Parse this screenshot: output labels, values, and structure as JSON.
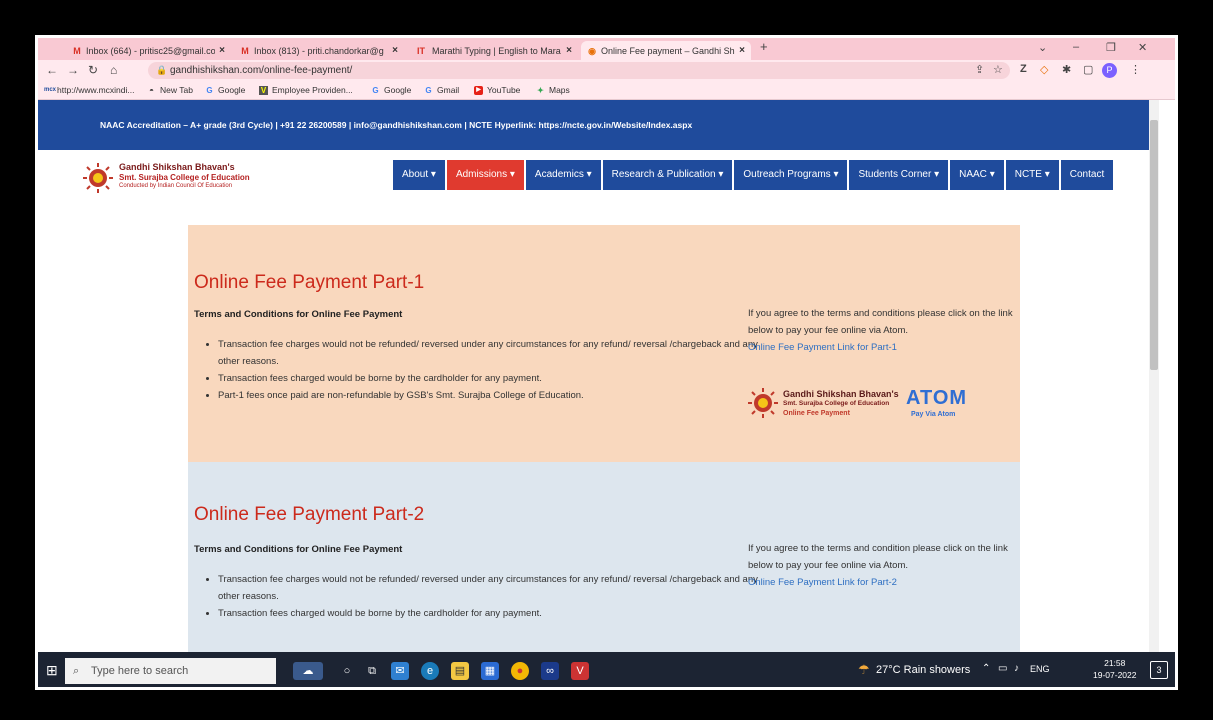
{
  "browser": {
    "tabs": [
      {
        "label": "Inbox (664) - pritisc25@gmail.co",
        "icon": "M",
        "color": "#d93025"
      },
      {
        "label": "Inbox (813) - priti.chandorkar@g",
        "icon": "M",
        "color": "#d93025"
      },
      {
        "label": "Marathi Typing | English to Mara",
        "icon": "IT",
        "color": "#d93025"
      },
      {
        "label": "Online Fee payment – Gandhi Sh",
        "icon": "◉",
        "color": "#e8710a"
      }
    ],
    "new_tab": "+",
    "url": "gandhishikshan.com/online-fee-payment/",
    "profile_initial": "P",
    "bookmarks": [
      {
        "label": "http://www.mcxindi...",
        "icon": "mcx"
      },
      {
        "label": "New Tab",
        "icon": "◓"
      },
      {
        "label": "Google",
        "icon": "G"
      },
      {
        "label": "Employee Providen...",
        "icon": "V"
      },
      {
        "label": "Google",
        "icon": "G"
      },
      {
        "label": "Gmail",
        "icon": "G"
      },
      {
        "label": "YouTube",
        "icon": "▶"
      },
      {
        "label": "Maps",
        "icon": "✦"
      }
    ]
  },
  "site": {
    "topbar": "NAAC Accreditation – A+ grade (3rd Cycle) | +91 22 26200589 | info@gandhishikshan.com | NCTE Hyperlink: https://ncte.gov.in/Website/Index.aspx",
    "logo_line1": "Gandhi Shikshan Bhavan's",
    "logo_line2": "Smt. Surajba College of Education",
    "logo_line3": "Conducted by Indian Council Of Education",
    "nav": [
      {
        "label": "About",
        "caret": "▾"
      },
      {
        "label": "Admissions",
        "caret": "▾"
      },
      {
        "label": "Academics",
        "caret": "▾"
      },
      {
        "label": "Research & Publication",
        "caret": "▾"
      },
      {
        "label": "Outreach Programs",
        "caret": "▾"
      },
      {
        "label": "Students Corner",
        "caret": "▾"
      },
      {
        "label": "NAAC",
        "caret": "▾"
      },
      {
        "label": "NCTE",
        "caret": "▾"
      },
      {
        "label": "Contact",
        "caret": ""
      }
    ],
    "section1": {
      "title": "Online Fee Payment Part-1",
      "terms_heading": "Terms and Conditions for Online Fee Payment",
      "bullets": [
        "Transaction fee charges would not be refunded/ reversed under any circumstances for any refund/ reversal /chargeback and any other reasons.",
        "Transaction fees charged would be borne by the cardholder for any payment.",
        "Part-1 fees once paid are non-refundable by GSB's Smt. Surajba College of Education."
      ],
      "right_text": "If you agree to the terms and conditions please click on the link below to pay your fee online via Atom.",
      "link": "Online Fee Payment Link for Part-1",
      "pay_img_line1": "Gandhi Shikshan Bhavan's",
      "pay_img_line2": "Smt. Surajba College of Education",
      "pay_img_line3": "Online Fee Payment",
      "pay_img_atom": "ATOM",
      "pay_img_via": "Pay Via Atom"
    },
    "section2": {
      "title": "Online Fee Payment Part-2",
      "terms_heading": "Terms and Conditions for Online Fee Payment",
      "bullets": [
        "Transaction fee charges would not be refunded/ reversed under any circumstances for any refund/ reversal /chargeback and any other reasons.",
        "Transaction fees charged would be borne by the cardholder for any payment."
      ],
      "right_text": "If you agree to the terms and condition please click on the link below to pay your fee online via Atom.",
      "link": "Online Fee Payment Link for Part-2"
    }
  },
  "taskbar": {
    "search_placeholder": "Type here to search",
    "weather": "27°C  Rain showers",
    "language": "ENG",
    "time": "21:58",
    "date": "19-07-2022",
    "notifications": "3"
  }
}
